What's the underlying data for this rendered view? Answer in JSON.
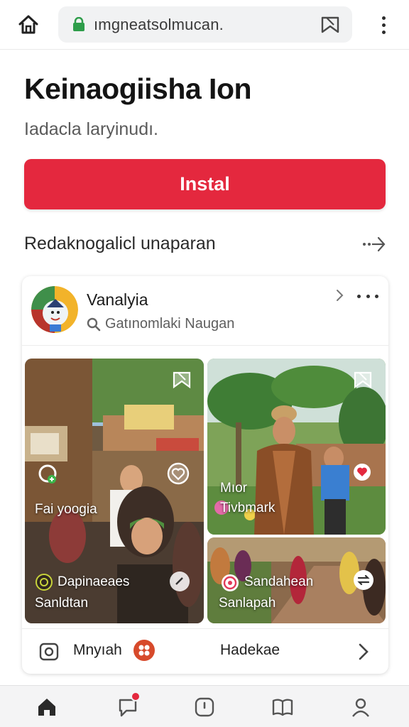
{
  "browser": {
    "url": "ımgneatsolmucan.",
    "icons": [
      "home-icon",
      "lock-icon",
      "bookmark-icon",
      "more-vert-icon"
    ]
  },
  "app": {
    "title": "Keinaogiisha Ion",
    "subtitle": "Iadacla laryinudı.",
    "install_label": "Instal",
    "accent": "#e4283e"
  },
  "section": {
    "title": "Redaknogalicl unaparan",
    "more_icon": "arrow-right-icon"
  },
  "card": {
    "name": "Vanalyia",
    "meta": "Gatınomlaki Naugan",
    "tiles": [
      {
        "caption": "Fai yoogia"
      },
      {
        "caption_line1": "Mıor",
        "caption_line2": "Tivbmark"
      },
      {
        "caption_line1": "Dapinaeaes",
        "caption_line2": "Sanldtan"
      },
      {
        "caption_line1": "Sandahean",
        "caption_line2": "Sanlapah"
      }
    ],
    "footer": {
      "left_label": "Mnyıah",
      "right_label": "Hadekae"
    }
  },
  "bottom_nav": {
    "items": [
      "home-icon",
      "chat-icon",
      "clock-icon",
      "book-icon",
      "profile-icon"
    ],
    "badge_color": "#e4283e"
  }
}
